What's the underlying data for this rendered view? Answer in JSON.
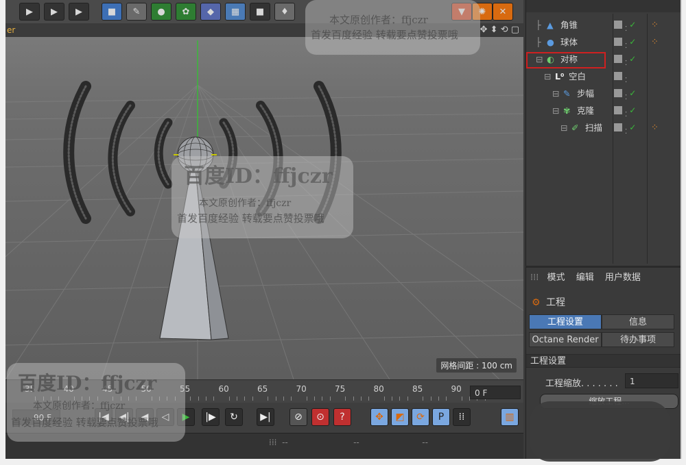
{
  "toolbar": {
    "icons": [
      "film-icon",
      "film-icon",
      "film-icon",
      "cube-icon",
      "pen-icon",
      "sphere-icon",
      "spline-icon",
      "camera-icon",
      "bulb-icon"
    ]
  },
  "viewport": {
    "header_text": "er",
    "grid_spacing": "网格间距 : 100 cm"
  },
  "timeline": {
    "ticks": [
      "35",
      "40",
      "45",
      "50",
      "55",
      "60",
      "65",
      "70",
      "75",
      "80",
      "85",
      "90"
    ],
    "current_frame": "0 F",
    "end_frame": "90 F"
  },
  "object_manager": {
    "objects": [
      {
        "name": "角锥",
        "icon": "cone-icon",
        "indent": 0
      },
      {
        "name": "球体",
        "icon": "sphere-icon",
        "indent": 0
      },
      {
        "name": "对称",
        "icon": "symmetry-icon",
        "indent": 0,
        "highlighted": true
      },
      {
        "name": "空白",
        "icon": "null-icon",
        "indent": 1
      },
      {
        "name": "步幅",
        "icon": "step-icon",
        "indent": 2
      },
      {
        "name": "克隆",
        "icon": "cloner-icon",
        "indent": 2
      },
      {
        "name": "扫描",
        "icon": "sweep-icon",
        "indent": 3
      }
    ]
  },
  "attributes": {
    "menu": [
      "模式",
      "编辑",
      "用户数据"
    ],
    "title": "工程",
    "tabs": [
      "工程设置",
      "信息",
      "Octane Render",
      "待办事项"
    ],
    "section": "工程设置",
    "scale_label": "工程缩放. . . . . . .",
    "scale_value": "1",
    "scale_button": "缩放工程..."
  },
  "watermarks": {
    "title": "百度ID：ffjczr",
    "author": "本文原创作者：ffjczr",
    "notice": "首发百度经验  转载要点赞投票哦",
    "notice2": "首发百度经验 转载要点赞投票哦",
    "brand": "百度"
  },
  "colors": {
    "highlight": "#d02020",
    "accent_tab": "#4a78b5",
    "green_axis": "#3ab83a",
    "orange_play": "#d86a10"
  }
}
